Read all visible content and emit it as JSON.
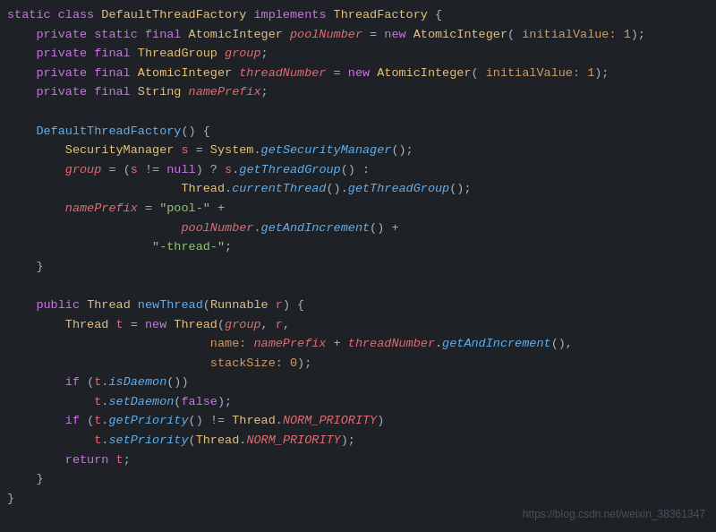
{
  "editor": {
    "background": "#1e2227",
    "watermark": "https://blog.csdn.net/weixin_38361347"
  },
  "lines": [
    {
      "gutter": "",
      "tokens": [
        {
          "t": "static ",
          "c": "kw"
        },
        {
          "t": "class ",
          "c": "kw"
        },
        {
          "t": "DefaultThreadFactory ",
          "c": "classname"
        },
        {
          "t": "implements ",
          "c": "kw"
        },
        {
          "t": "ThreadFactory ",
          "c": "iface"
        },
        {
          "t": "{",
          "c": "plain"
        }
      ]
    },
    {
      "gutter": "",
      "tokens": [
        {
          "t": "    ",
          "c": "plain"
        },
        {
          "t": "private ",
          "c": "kw"
        },
        {
          "t": "static ",
          "c": "kw"
        },
        {
          "t": "final ",
          "c": "kw"
        },
        {
          "t": "AtomicInteger ",
          "c": "type"
        },
        {
          "t": "poolNumber",
          "c": "field-it"
        },
        {
          "t": " = ",
          "c": "plain"
        },
        {
          "t": "new ",
          "c": "kw"
        },
        {
          "t": "AtomicInteger",
          "c": "type"
        },
        {
          "t": "( ",
          "c": "plain"
        },
        {
          "t": "initialValue: ",
          "c": "param"
        },
        {
          "t": "1",
          "c": "num"
        },
        {
          "t": ");",
          "c": "plain"
        }
      ]
    },
    {
      "gutter": "",
      "tokens": [
        {
          "t": "    ",
          "c": "plain"
        },
        {
          "t": "private ",
          "c": "kw"
        },
        {
          "t": "final ",
          "c": "kw"
        },
        {
          "t": "ThreadGroup ",
          "c": "type"
        },
        {
          "t": "group",
          "c": "field-it"
        },
        {
          "t": ";",
          "c": "plain"
        }
      ]
    },
    {
      "gutter": "",
      "tokens": [
        {
          "t": "    ",
          "c": "plain"
        },
        {
          "t": "private ",
          "c": "kw"
        },
        {
          "t": "final ",
          "c": "kw"
        },
        {
          "t": "AtomicInteger ",
          "c": "type"
        },
        {
          "t": "threadNumber",
          "c": "field-it"
        },
        {
          "t": " = ",
          "c": "plain"
        },
        {
          "t": "new ",
          "c": "kw"
        },
        {
          "t": "AtomicInteger",
          "c": "type"
        },
        {
          "t": "( ",
          "c": "plain"
        },
        {
          "t": "initialValue: ",
          "c": "param"
        },
        {
          "t": "1",
          "c": "num"
        },
        {
          "t": ");",
          "c": "plain"
        }
      ]
    },
    {
      "gutter": "",
      "tokens": [
        {
          "t": "    ",
          "c": "plain"
        },
        {
          "t": "private ",
          "c": "kw"
        },
        {
          "t": "final ",
          "c": "kw"
        },
        {
          "t": "String ",
          "c": "type"
        },
        {
          "t": "namePrefix",
          "c": "field-it"
        },
        {
          "t": ";",
          "c": "plain"
        }
      ]
    },
    {
      "gutter": "",
      "tokens": []
    },
    {
      "gutter": "",
      "tokens": [
        {
          "t": "    ",
          "c": "plain"
        },
        {
          "t": "DefaultThreadFactory",
          "c": "method"
        },
        {
          "t": "() {",
          "c": "plain"
        }
      ]
    },
    {
      "gutter": "",
      "tokens": [
        {
          "t": "        ",
          "c": "plain"
        },
        {
          "t": "SecurityManager ",
          "c": "type"
        },
        {
          "t": "s",
          "c": "var"
        },
        {
          "t": " = ",
          "c": "plain"
        },
        {
          "t": "System",
          "c": "type"
        },
        {
          "t": ".",
          "c": "plain"
        },
        {
          "t": "getSecurityManager",
          "c": "method-it"
        },
        {
          "t": "();",
          "c": "plain"
        }
      ]
    },
    {
      "gutter": "",
      "tokens": [
        {
          "t": "        ",
          "c": "plain"
        },
        {
          "t": "group",
          "c": "field-it"
        },
        {
          "t": " = (",
          "c": "plain"
        },
        {
          "t": "s",
          "c": "var"
        },
        {
          "t": " != ",
          "c": "plain"
        },
        {
          "t": "null",
          "c": "kw"
        },
        {
          "t": ") ? ",
          "c": "plain"
        },
        {
          "t": "s",
          "c": "var"
        },
        {
          "t": ".",
          "c": "plain"
        },
        {
          "t": "getThreadGroup",
          "c": "method-it"
        },
        {
          "t": "() :",
          "c": "plain"
        }
      ]
    },
    {
      "gutter": "",
      "tokens": [
        {
          "t": "                        ",
          "c": "plain"
        },
        {
          "t": "Thread",
          "c": "type"
        },
        {
          "t": ".",
          "c": "plain"
        },
        {
          "t": "currentThread",
          "c": "method-it"
        },
        {
          "t": "().",
          "c": "plain"
        },
        {
          "t": "getThreadGroup",
          "c": "method-it"
        },
        {
          "t": "();",
          "c": "plain"
        }
      ]
    },
    {
      "gutter": "",
      "tokens": [
        {
          "t": "        ",
          "c": "plain"
        },
        {
          "t": "namePrefix",
          "c": "field-it"
        },
        {
          "t": " = ",
          "c": "plain"
        },
        {
          "t": "\"pool-\"",
          "c": "string"
        },
        {
          "t": " +",
          "c": "plain"
        }
      ]
    },
    {
      "gutter": "",
      "tokens": [
        {
          "t": "                        ",
          "c": "plain"
        },
        {
          "t": "poolNumber",
          "c": "field-it"
        },
        {
          "t": ".",
          "c": "plain"
        },
        {
          "t": "getAndIncrement",
          "c": "method-it"
        },
        {
          "t": "() +",
          "c": "plain"
        }
      ]
    },
    {
      "gutter": "",
      "tokens": [
        {
          "t": "                    ",
          "c": "plain"
        },
        {
          "t": "\"-thread-\"",
          "c": "string"
        },
        {
          "t": ";",
          "c": "plain"
        }
      ]
    },
    {
      "gutter": "",
      "tokens": [
        {
          "t": "    ",
          "c": "plain"
        },
        {
          "t": "}",
          "c": "plain"
        }
      ]
    },
    {
      "gutter": "",
      "tokens": []
    },
    {
      "gutter": "",
      "tokens": [
        {
          "t": "    ",
          "c": "plain"
        },
        {
          "t": "public ",
          "c": "kw"
        },
        {
          "t": "Thread ",
          "c": "type"
        },
        {
          "t": "newThread",
          "c": "method"
        },
        {
          "t": "(",
          "c": "plain"
        },
        {
          "t": "Runnable ",
          "c": "type"
        },
        {
          "t": "r",
          "c": "var"
        },
        {
          "t": ") {",
          "c": "plain"
        }
      ]
    },
    {
      "gutter": "",
      "tokens": [
        {
          "t": "        ",
          "c": "plain"
        },
        {
          "t": "Thread ",
          "c": "type"
        },
        {
          "t": "t",
          "c": "var"
        },
        {
          "t": " = ",
          "c": "plain"
        },
        {
          "t": "new ",
          "c": "kw"
        },
        {
          "t": "Thread",
          "c": "type"
        },
        {
          "t": "(",
          "c": "plain"
        },
        {
          "t": "group",
          "c": "field-it"
        },
        {
          "t": ", ",
          "c": "plain"
        },
        {
          "t": "r",
          "c": "var"
        },
        {
          "t": ",",
          "c": "plain"
        }
      ]
    },
    {
      "gutter": "",
      "tokens": [
        {
          "t": "                            ",
          "c": "plain"
        },
        {
          "t": "name: ",
          "c": "param"
        },
        {
          "t": "namePrefix",
          "c": "field-it"
        },
        {
          "t": " + ",
          "c": "plain"
        },
        {
          "t": "threadNumber",
          "c": "field-it"
        },
        {
          "t": ".",
          "c": "plain"
        },
        {
          "t": "getAndIncrement",
          "c": "method-it"
        },
        {
          "t": "(),",
          "c": "plain"
        }
      ]
    },
    {
      "gutter": "",
      "tokens": [
        {
          "t": "                            ",
          "c": "plain"
        },
        {
          "t": "stackSize: ",
          "c": "param"
        },
        {
          "t": "0",
          "c": "num"
        },
        {
          "t": ");",
          "c": "plain"
        }
      ]
    },
    {
      "gutter": "",
      "tokens": [
        {
          "t": "        ",
          "c": "plain"
        },
        {
          "t": "if ",
          "c": "kw"
        },
        {
          "t": "(",
          "c": "plain"
        },
        {
          "t": "t",
          "c": "var"
        },
        {
          "t": ".",
          "c": "plain"
        },
        {
          "t": "isDaemon",
          "c": "method-it"
        },
        {
          "t": "())",
          "c": "plain"
        }
      ]
    },
    {
      "gutter": "",
      "tokens": [
        {
          "t": "            ",
          "c": "plain"
        },
        {
          "t": "t",
          "c": "var"
        },
        {
          "t": ".",
          "c": "plain"
        },
        {
          "t": "setDaemon",
          "c": "method-it"
        },
        {
          "t": "(",
          "c": "plain"
        },
        {
          "t": "false",
          "c": "kw"
        },
        {
          "t": ");",
          "c": "plain"
        }
      ]
    },
    {
      "gutter": "",
      "tokens": [
        {
          "t": "        ",
          "c": "plain"
        },
        {
          "t": "if ",
          "c": "kw"
        },
        {
          "t": "(",
          "c": "plain"
        },
        {
          "t": "t",
          "c": "var"
        },
        {
          "t": ".",
          "c": "plain"
        },
        {
          "t": "getPriority",
          "c": "method-it"
        },
        {
          "t": "() != ",
          "c": "plain"
        },
        {
          "t": "Thread",
          "c": "type"
        },
        {
          "t": ".",
          "c": "plain"
        },
        {
          "t": "NORM_PRIORITY",
          "c": "field-it"
        },
        {
          "t": ")",
          "c": "plain"
        }
      ]
    },
    {
      "gutter": "",
      "tokens": [
        {
          "t": "            ",
          "c": "plain"
        },
        {
          "t": "t",
          "c": "var"
        },
        {
          "t": ".",
          "c": "plain"
        },
        {
          "t": "setPriority",
          "c": "method-it"
        },
        {
          "t": "(",
          "c": "plain"
        },
        {
          "t": "Thread",
          "c": "type"
        },
        {
          "t": ".",
          "c": "plain"
        },
        {
          "t": "NORM_PRIORITY",
          "c": "field-it"
        },
        {
          "t": ");",
          "c": "plain"
        }
      ]
    },
    {
      "gutter": "",
      "tokens": [
        {
          "t": "        ",
          "c": "plain"
        },
        {
          "t": "return ",
          "c": "kw"
        },
        {
          "t": "t",
          "c": "var"
        },
        {
          "t": ";",
          "c": "plain"
        }
      ]
    },
    {
      "gutter": "",
      "tokens": [
        {
          "t": "    ",
          "c": "plain"
        },
        {
          "t": "}",
          "c": "plain"
        }
      ]
    },
    {
      "gutter": "",
      "tokens": [
        {
          "t": "}",
          "c": "plain"
        }
      ]
    }
  ]
}
